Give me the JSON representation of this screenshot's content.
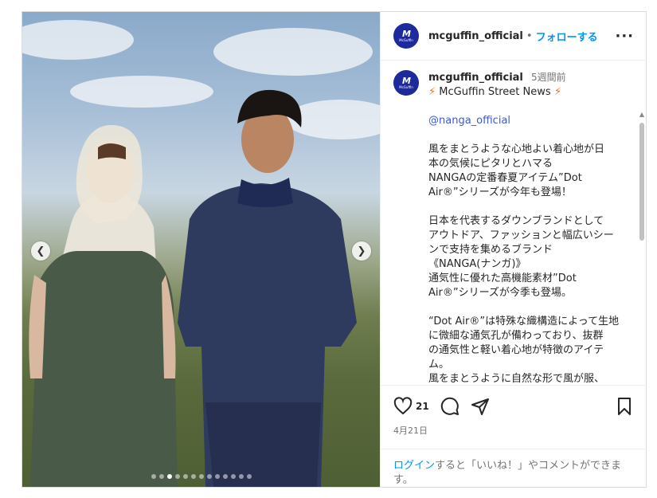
{
  "account": {
    "username": "mcguffin_official",
    "separator": "•",
    "follow_label": "フォローする",
    "more_icon": "more-horizontal-icon",
    "avatar_text": "M",
    "avatar_subtext": "McGuffin"
  },
  "caption": {
    "username": "mcguffin_official",
    "time_ago": "5週間前",
    "headline_icon": "lightning-icon",
    "headline": "McGuffin Street News",
    "mention": "@nanga_official",
    "lines": [
      "風をまとうような心地よい着心地が日",
      "本の気候にピタリとハマる",
      "NANGAの定番春夏アイテム”Dot",
      "Air®”シリーズが今年も登場！",
      "",
      "日本を代表するダウンブランドとして",
      "アウトドア、ファッションと幅広いシー",
      "ンで支持を集めるブランド",
      "《NANGA(ナンガ)》",
      "通気性に優れた高機能素材”Dot",
      "Air®”シリーズが今季も登場。",
      "",
      "“Dot Air®”は特殊な織構造によって生地",
      "に微細な通気孔が備わっており、抜群",
      "の通気性と軽い着心地が特徴のアイテ",
      "ム。",
      "風をまとうように自然な形で風が服、"
    ]
  },
  "actions": {
    "like_icon": "heart-icon",
    "like_count": "21",
    "comment_icon": "comment-icon",
    "share_icon": "share-icon",
    "save_icon": "bookmark-icon"
  },
  "date": "4月21日",
  "login_prompt": {
    "link": "ログイン",
    "text": "すると「いいね！」やコメントができます。"
  },
  "carousel": {
    "slide_count": 13,
    "active_index": 2
  },
  "colors": {
    "brand": "#1c2a9c",
    "follow": "#0095f6",
    "mention": "#3a5ad9",
    "bolt": "#f26b1d"
  }
}
